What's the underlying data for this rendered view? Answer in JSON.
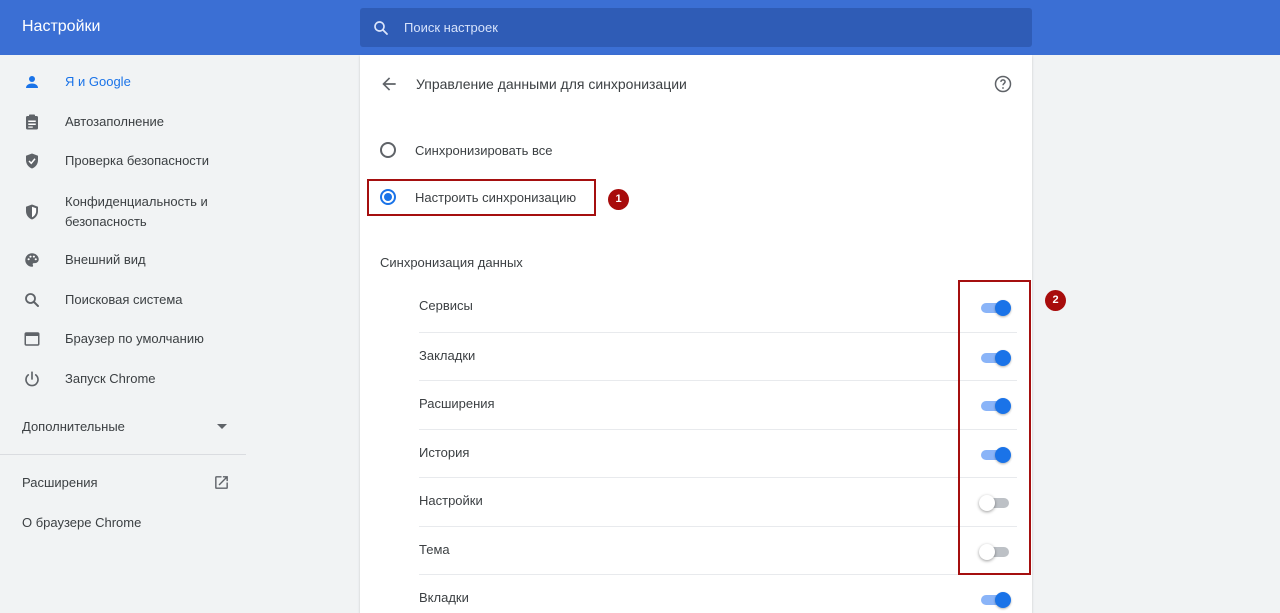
{
  "header": {
    "title": "Настройки",
    "search_placeholder": "Поиск настроек"
  },
  "sidebar": {
    "items": [
      {
        "label": "Я и Google",
        "icon": "person-icon",
        "active": true
      },
      {
        "label": "Автозаполнение",
        "icon": "clipboard-icon"
      },
      {
        "label": "Проверка безопасности",
        "icon": "shield-check-icon"
      },
      {
        "label": "Конфиденциальность и безопасность",
        "icon": "shield-half-icon"
      },
      {
        "label": "Внешний вид",
        "icon": "palette-icon"
      },
      {
        "label": "Поисковая система",
        "icon": "search-icon"
      },
      {
        "label": "Браузер по умолчанию",
        "icon": "browser-window-icon"
      },
      {
        "label": "Запуск Chrome",
        "icon": "power-icon"
      }
    ],
    "advanced_label": "Дополнительные",
    "extensions_label": "Расширения",
    "about_label": "О браузере Chrome"
  },
  "main": {
    "title": "Управление данными для синхронизации",
    "options": [
      {
        "label": "Синхронизировать все",
        "checked": false
      },
      {
        "label": "Настроить синхронизацию",
        "checked": true
      }
    ],
    "section_title": "Синхронизация данных",
    "sync_items": [
      {
        "label": "Сервисы",
        "on": true
      },
      {
        "label": "Закладки",
        "on": true
      },
      {
        "label": "Расширения",
        "on": true
      },
      {
        "label": "История",
        "on": true
      },
      {
        "label": "Настройки",
        "on": false
      },
      {
        "label": "Тема",
        "on": false
      },
      {
        "label": "Вкладки",
        "on": true
      }
    ]
  },
  "annotations": {
    "badge1": "1",
    "badge2": "2"
  },
  "colors": {
    "header": "#3b6fd4",
    "accent": "#1a73e8",
    "annotation": "#a80c0c"
  }
}
